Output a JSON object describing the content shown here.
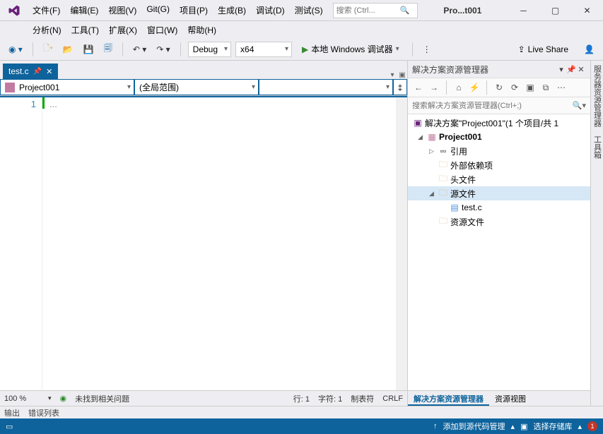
{
  "menu1": [
    "文件(F)",
    "编辑(E)",
    "视图(V)",
    "Git(G)",
    "项目(P)",
    "生成(B)",
    "调试(D)",
    "测试(S)"
  ],
  "menu2": [
    "分析(N)",
    "工具(T)",
    "扩展(X)",
    "窗口(W)",
    "帮助(H)"
  ],
  "search_placeholder": "搜索 (Ctrl...",
  "solution_title": "Pro...t001",
  "toolbar": {
    "config": "Debug",
    "platform": "x64",
    "start_label": "本地 Windows 调试器",
    "liveshare": "Live Share"
  },
  "tab": {
    "name": "test.c"
  },
  "nav": {
    "project": "Project001",
    "scope": "(全局范围)",
    "member": ""
  },
  "code": {
    "line_no": "1",
    "content": "..."
  },
  "editor_status": {
    "zoom": "100 %",
    "issues": "未找到相关问题",
    "line": "行: 1",
    "col": "字符: 1",
    "tabs": "制表符",
    "eol": "CRLF"
  },
  "solution_panel": {
    "title": "解决方案资源管理器",
    "search_placeholder": "搜索解决方案资源管理器(Ctrl+;)",
    "root": "解决方案\"Project001\"(1 个项目/共 1",
    "project": "Project001",
    "refs": "引用",
    "external": "外部依赖项",
    "headers": "头文件",
    "sources": "源文件",
    "file": "test.c",
    "resources": "资源文件",
    "tab_active": "解决方案资源管理器",
    "tab_other": "资源视图"
  },
  "far_tabs": [
    "服务器资源管理器",
    "工具箱"
  ],
  "bottom_tabs": [
    "输出",
    "错误列表"
  ],
  "status": {
    "add_src": "添加到源代码管理",
    "repo": "选择存储库",
    "bell_count": "1"
  }
}
